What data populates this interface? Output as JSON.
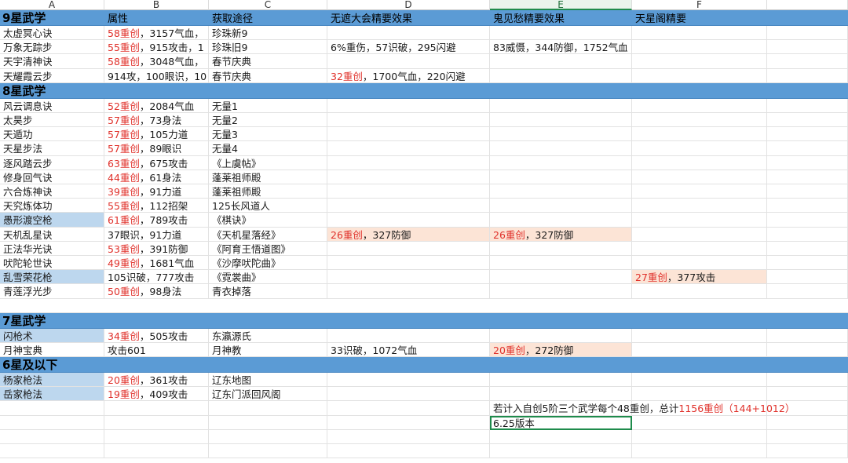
{
  "columns": [
    "A",
    "B",
    "C",
    "D",
    "E",
    "F"
  ],
  "selected_column": "E",
  "header_row": [
    "属性",
    "获取途径",
    "无遮大会精要效果",
    "鬼见愁精要效果",
    "天星阁精要"
  ],
  "sections": [
    {
      "title": "9星武学",
      "rows": [
        {
          "name": "太虚冥心诀",
          "attr_red": "58重创",
          "attr_rest": "，3157气血，",
          "source": "珍珠新9"
        },
        {
          "name": "万象无踪步",
          "attr_red": "55重创",
          "attr_rest": "，915攻击，1",
          "source": "珍珠旧9",
          "d": "6%重伤，57识破，295闪避",
          "e": "83威慑，344防御，1752气血"
        },
        {
          "name": "天宇清神诀",
          "attr_red": "58重创",
          "attr_rest": "，3048气血，",
          "source": "春节庆典"
        },
        {
          "name": "天耀霞云步",
          "attr_rest": "914攻，100眼识，10",
          "source": "春节庆典",
          "d_red": "32重创",
          "d": "，1700气血，220闪避"
        }
      ]
    },
    {
      "title": "8星武学",
      "rows": [
        {
          "name": "风云调息诀",
          "attr_red": "52重创",
          "attr_rest": "，2084气血",
          "source": "无量1"
        },
        {
          "name": "太昊步",
          "attr_red": "57重创",
          "attr_rest": "，73身法",
          "source": "无量2"
        },
        {
          "name": "天遁功",
          "attr_red": "57重创",
          "attr_rest": "，105力道",
          "source": "无量3"
        },
        {
          "name": "天星步法",
          "attr_red": "57重创",
          "attr_rest": "，89眼识",
          "source": "无量4"
        },
        {
          "name": "逐风踏云步",
          "attr_red": "63重创",
          "attr_rest": "，675攻击",
          "source": "《上虞帖》"
        },
        {
          "name": "修身回气诀",
          "attr_red": "44重创",
          "attr_rest": "，61身法",
          "source": "蓬莱祖师殿"
        },
        {
          "name": "六合炼神诀",
          "attr_red": "39重创",
          "attr_rest": "，91力道",
          "source": "蓬莱祖师殿"
        },
        {
          "name": "天究炼体功",
          "attr_red": "55重创",
          "attr_rest": "，112招架",
          "source": "125长风道人"
        },
        {
          "name": "愚形渡空枪",
          "attr_red": "61重创",
          "attr_rest": "，789攻击",
          "source": "《棋诀》",
          "name_blue": true
        },
        {
          "name": "天机乱星诀",
          "attr_rest": "37眼识，91力道",
          "source": "《天机星落经》",
          "d_red": "26重创",
          "d": "，327防御",
          "e_red": "26重创",
          "e": "，327防御",
          "de_peach": true
        },
        {
          "name": "正法华光诀",
          "attr_red": "53重创",
          "attr_rest": "，391防御",
          "source": "《阿育王悟道图》"
        },
        {
          "name": "吠陀轮世诀",
          "attr_red": "49重创",
          "attr_rest": "，1681气血",
          "source": "《沙摩吠陀曲》"
        },
        {
          "name": "乱雪荣花枪",
          "attr_rest": "105识破，777攻击",
          "source": "《霓裳曲》",
          "name_blue": true,
          "f_red": "27重创",
          "f": "，377攻击"
        },
        {
          "name": "青莲浮光步",
          "attr_red": "50重创",
          "attr_rest": "，98身法",
          "source": "青衣掉落"
        }
      ]
    },
    {
      "title": "7星武学",
      "rows": [
        {
          "name": "闪枪术",
          "attr_red": "34重创",
          "attr_rest": "，505攻击",
          "source": "东瀛源氏",
          "name_blue": true
        },
        {
          "name": "月神宝典",
          "attr_rest": "攻击601",
          "source": "月神教",
          "d": "33识破，1072气血",
          "e_red": "20重创",
          "e": "，272防御",
          "e_peach": true
        }
      ]
    },
    {
      "title": "6星及以下",
      "rows": [
        {
          "name": "杨家枪法",
          "attr_red": "20重创",
          "attr_rest": "，361攻击",
          "source": "辽东地图",
          "name_blue": true
        },
        {
          "name": "岳家枪法",
          "attr_red": "19重创",
          "attr_rest": "，409攻击",
          "source": "辽东门派回风阁",
          "name_blue": true
        }
      ]
    }
  ],
  "note": {
    "prefix": "若计入自创5阶三个武学每个48重创，总计",
    "red": "1156重创（144+1012）"
  },
  "version": "6.25版本",
  "colors": {
    "section": "#5b9bd5",
    "blue_fill": "#bdd7ee",
    "peach_fill": "#fce4d6",
    "red_text": "#e0302a",
    "select": "#1f8b4c"
  }
}
